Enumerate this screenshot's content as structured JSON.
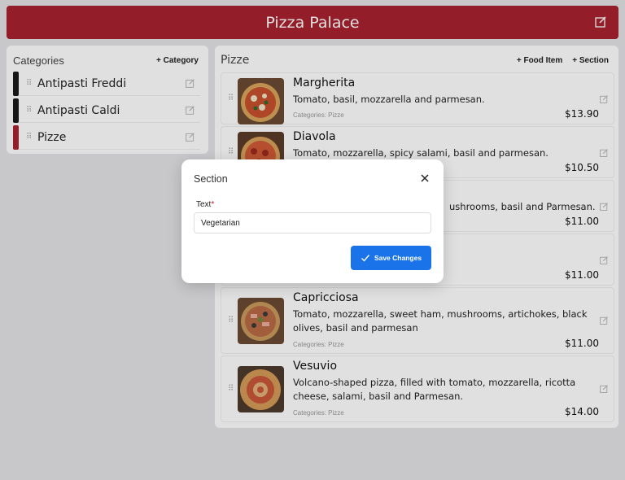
{
  "header": {
    "title": "Pizza Palace",
    "edit_icon": "edit-icon"
  },
  "categories": {
    "title": "Categories",
    "add_label": "+ Category",
    "items": [
      {
        "label": "Antipasti Freddi",
        "color": "#1a1a1a"
      },
      {
        "label": "Antipasti Caldi",
        "color": "#1a1a1a"
      },
      {
        "label": "Pizze",
        "color": "#a8222e"
      }
    ]
  },
  "menu": {
    "title": "Pizze",
    "add_food_label": "+ Food Item",
    "add_section_label": "+ Section",
    "items": [
      {
        "name": "Margherita",
        "description": "Tomato, basil, mozzarella and parmesan.",
        "categories": "Categories: Pizze",
        "price": "$13.90"
      },
      {
        "name": "Diavola",
        "description": "Tomato, mozzarella, spicy salami, basil and parmesan.",
        "categories": "",
        "price": "$10.50"
      },
      {
        "name": "",
        "description": "ushrooms, basil and Parmesan.",
        "categories": "",
        "price": "$11.00"
      },
      {
        "name": "",
        "description": "",
        "categories": "",
        "price": "$11.00"
      },
      {
        "name": "Capricciosa",
        "description": "Tomato, mozzarella, sweet ham, mushrooms, artichokes, black olives, basil and parmesan",
        "categories": "Categories: Pizze",
        "price": "$11.00"
      },
      {
        "name": "Vesuvio",
        "description": "Volcano-shaped pizza, filled with tomato, mozzarella, ricotta cheese, salami, basil and Parmesan.",
        "categories": "Categories: Pizze",
        "price": "$14.00"
      }
    ]
  },
  "modal": {
    "title": "Section",
    "field_label": "Text",
    "required_mark": "*",
    "field_value": "Vegetarian",
    "save_label": "Save Changes",
    "accent": "#1a73e8"
  }
}
